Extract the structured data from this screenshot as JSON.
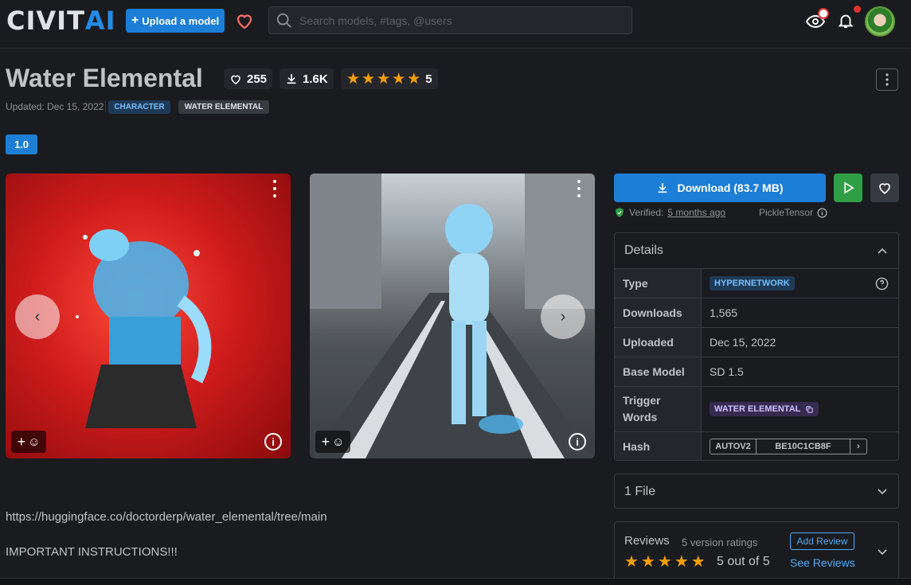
{
  "header": {
    "logo_part1": "CIVIT",
    "logo_part2": "AI",
    "upload_label": "Upload a model",
    "search_placeholder": "Search models, #tags, @users"
  },
  "model": {
    "title": "Water Elemental",
    "likes": "255",
    "downloads_short": "1.6K",
    "rating": "5",
    "updated": "Updated: Dec 15, 2022",
    "tags": [
      "CHARACTER",
      "WATER ELEMENTAL"
    ],
    "version": "1.0"
  },
  "gallery": {
    "react_icon": "plus-smiley-icon",
    "info_icon": "info-icon"
  },
  "download": {
    "label": "Download (83.7 MB)",
    "verified_prefix": "Verified:",
    "verified_time": "5 months ago",
    "author": "PickleTensor"
  },
  "details": {
    "title": "Details",
    "rows": [
      {
        "key": "Type",
        "value": "HYPERNETWORK"
      },
      {
        "key": "Downloads",
        "value": "1,565"
      },
      {
        "key": "Uploaded",
        "value": "Dec 15, 2022"
      },
      {
        "key": "Base Model",
        "value": "SD 1.5"
      },
      {
        "key": "Trigger Words",
        "value": "WATER ELEMENTAL"
      },
      {
        "key": "Hash",
        "value_type": "AUTOV2",
        "value_hash": "BE10C1CB8F"
      }
    ]
  },
  "files": {
    "title": "1 File"
  },
  "reviews": {
    "title": "Reviews",
    "subtitle": "5 version ratings",
    "score": "5 out of 5",
    "add_label": "Add Review",
    "see_label": "See Reviews"
  },
  "description": {
    "link": "https://huggingface.co/doctorderp/water_elemental/tree/main",
    "text": "IMPORTANT INSTRUCTIONS!!!"
  },
  "colors": {
    "accent": "#1c7ed6",
    "star": "#f59f00",
    "success": "#2f9e44",
    "background": "#1a1b1e"
  }
}
